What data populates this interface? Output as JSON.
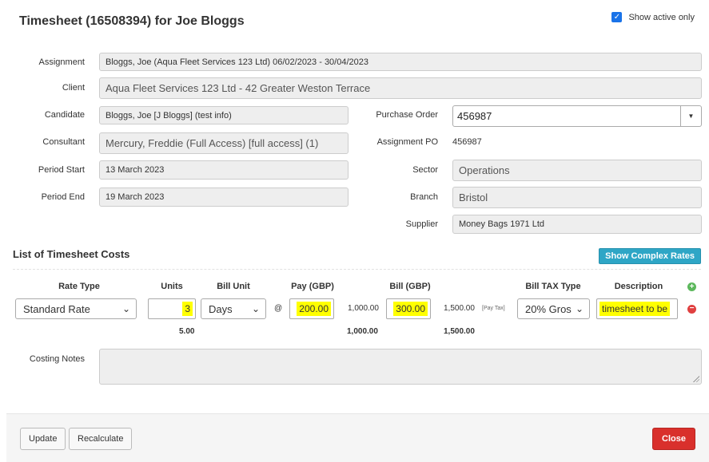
{
  "header": {
    "title": "Timesheet (16508394) for Joe Bloggs",
    "show_active_label": "Show active only",
    "show_active_checked": true
  },
  "details": {
    "assignment_label": "Assignment",
    "assignment_value": "Bloggs, Joe (Aqua Fleet Services 123 Ltd) 06/02/2023 - 30/04/2023",
    "client_label": "Client",
    "client_value": "Aqua Fleet Services 123 Ltd - 42 Greater Weston Terrace",
    "candidate_label": "Candidate",
    "candidate_value": "Bloggs, Joe [J Bloggs] (test info)",
    "consultant_label": "Consultant",
    "consultant_value": "Mercury, Freddie (Full Access) [full access] (1)",
    "period_start_label": "Period Start",
    "period_start_value": "13 March 2023",
    "period_end_label": "Period End",
    "period_end_value": "19 March 2023",
    "purchase_order_label": "Purchase Order",
    "purchase_order_value": "456987",
    "assignment_po_label": "Assignment PO",
    "assignment_po_value": "456987",
    "sector_label": "Sector",
    "sector_value": "Operations",
    "branch_label": "Branch",
    "branch_value": "Bristol",
    "supplier_label": "Supplier",
    "supplier_value": "Money Bags 1971 Ltd"
  },
  "costs": {
    "section_title": "List of Timesheet Costs",
    "show_complex_rates_label": "Show Complex Rates",
    "columns": {
      "rate_type": "Rate Type",
      "units": "Units",
      "bill_unit": "Bill Unit",
      "pay": "Pay (GBP)",
      "bill": "Bill (GBP)",
      "bill_tax_type": "Bill TAX Type",
      "description": "Description"
    },
    "row": {
      "rate_type": "Standard Rate",
      "units": "3",
      "bill_unit": "Days",
      "at": "@",
      "pay": "200.00",
      "pay_total": "1,000.00",
      "bill": "300.00",
      "bill_total": "1,500.00",
      "pay_tax_note": "[Pay Tax]",
      "bill_tax_type": "20% Gros",
      "description": "timesheet to be"
    },
    "totals": {
      "units": "5.00",
      "pay": "1,000.00",
      "bill": "1,500.00"
    },
    "costing_notes_label": "Costing Notes",
    "costing_notes_value": ""
  },
  "footer": {
    "update_label": "Update",
    "recalculate_label": "Recalculate",
    "close_label": "Close"
  },
  "colors": {
    "highlight": "#ffff00",
    "complex_button": "#2ea6c6",
    "close_button": "#d9302c",
    "checkbox": "#1a73e8"
  }
}
